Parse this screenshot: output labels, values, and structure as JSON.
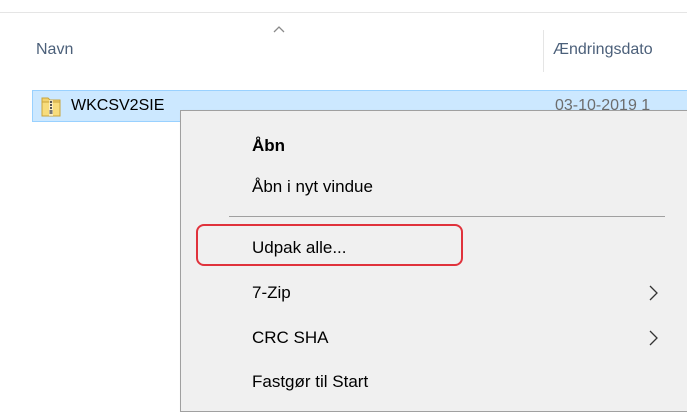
{
  "columns": {
    "name_label": "Navn",
    "date_label": "Ændringsdato",
    "sort_icon": "chevron-up-icon"
  },
  "file": {
    "name": "WKCSV2SIE",
    "date": "03-10-2019 1",
    "icon": "zip-folder-icon"
  },
  "context_menu": {
    "items": [
      {
        "label": "Åbn",
        "bold": true
      },
      {
        "label": "Åbn i nyt vindue"
      },
      {
        "label": "Udpak alle..."
      },
      {
        "label": "7-Zip",
        "submenu": true
      },
      {
        "label": "CRC SHA",
        "submenu": true
      },
      {
        "label": "Fastgør til Start"
      }
    ]
  },
  "colors": {
    "selection": "#cce8ff",
    "selection_border": "#99d1ff",
    "highlight": "#e0323c",
    "menu_bg": "#f0f0f0"
  }
}
